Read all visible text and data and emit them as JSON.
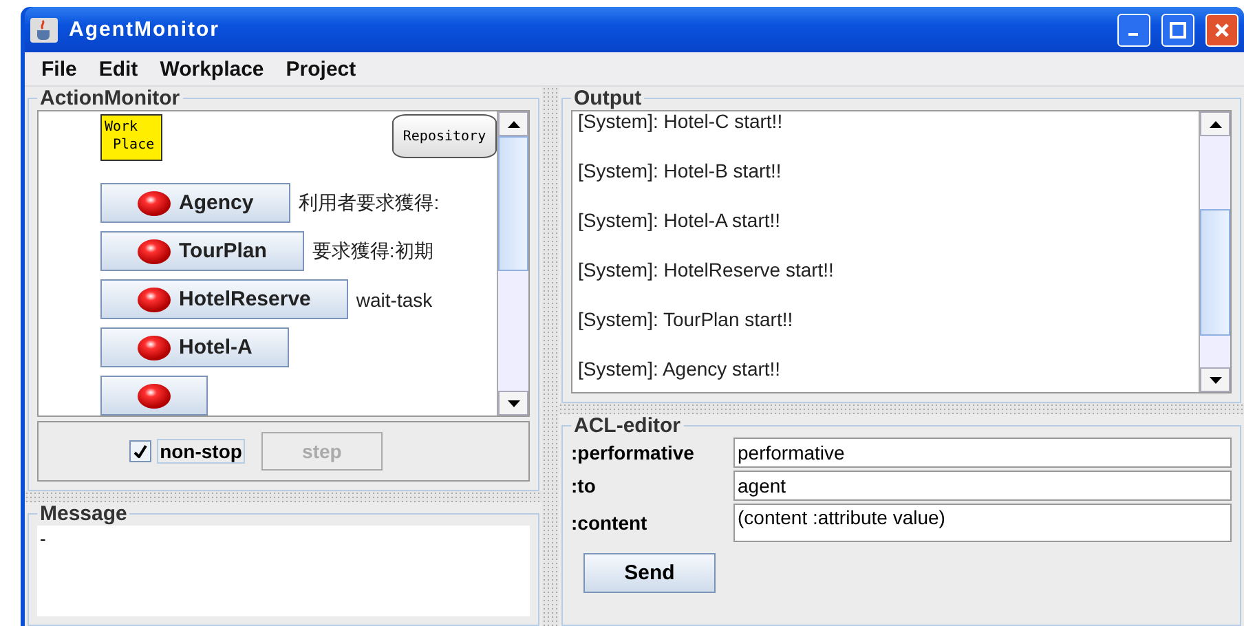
{
  "window": {
    "title": "AgentMonitor"
  },
  "menu": [
    "File",
    "Edit",
    "Workplace",
    "Project"
  ],
  "action_monitor": {
    "title": "ActionMonitor",
    "workplace": "Work\n Place",
    "repository": "Repository",
    "agents": [
      {
        "name": "Agency",
        "status": "利用者要求獲得:"
      },
      {
        "name": "TourPlan",
        "status": "要求獲得:初期"
      },
      {
        "name": "HotelReserve",
        "status": "wait-task"
      },
      {
        "name": "Hotel-A"
      }
    ],
    "non_stop": {
      "label": "non-stop",
      "checked": true
    },
    "step": {
      "label": "step",
      "disabled": true
    }
  },
  "message": {
    "title": "Message",
    "text": "-"
  },
  "output": {
    "title": "Output",
    "lines": [
      "[System]: Hotel-C start!!",
      "[System]: Hotel-B start!!",
      "[System]: Hotel-A start!!",
      "[System]: HotelReserve start!!",
      "[System]: TourPlan start!!",
      "[System]: Agency start!!"
    ]
  },
  "acl_editor": {
    "title": "ACL-editor",
    "fields": [
      {
        "label": ":performative",
        "value": "performative"
      },
      {
        "label": ":to",
        "value": "agent"
      },
      {
        "label": ":content",
        "value": "(content :attribute value)"
      }
    ],
    "send": "Send"
  }
}
